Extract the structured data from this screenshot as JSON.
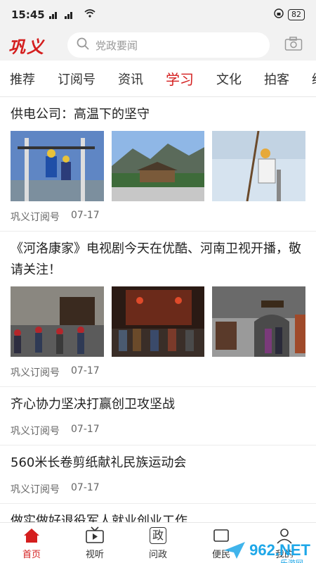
{
  "status": {
    "time": "15:45",
    "signal": "4G ₈ 4G",
    "battery": "82"
  },
  "header": {
    "logo": "巩义",
    "search_placeholder": "党政要闻"
  },
  "tabs": [
    "推荐",
    "订阅号",
    "资讯",
    "学习",
    "文化",
    "拍客",
    "经济"
  ],
  "active_tab": "学习",
  "articles": [
    {
      "title": "供电公司：高温下的坚守",
      "source": "巩义订阅号",
      "date": "07-17"
    },
    {
      "title": "《河洛康家》电视剧今天在优酷、河南卫视开播，敬请关注！",
      "source": "巩义订阅号",
      "date": "07-17"
    },
    {
      "title": "齐心协力坚决打赢创卫攻坚战",
      "source": "巩义订阅号",
      "date": "07-17"
    },
    {
      "title": "560米长卷剪纸献礼民族运动会",
      "source": "巩义订阅号",
      "date": "07-17"
    },
    {
      "title": "做实做好退役军人就业创业工作",
      "source": "",
      "date": ""
    }
  ],
  "nav": [
    {
      "label": "首页",
      "icon": "home-icon"
    },
    {
      "label": "视听",
      "icon": "tv-icon"
    },
    {
      "label": "问政",
      "icon": "politics-icon",
      "glyph": "政"
    },
    {
      "label": "便民",
      "icon": "service-icon"
    },
    {
      "label": "我的",
      "icon": "user-icon"
    }
  ],
  "watermark": {
    "main": "962.NET",
    "sub": "乐游网"
  },
  "colors": {
    "accent": "#d41e1e",
    "watermark": "#1ea7e8"
  }
}
